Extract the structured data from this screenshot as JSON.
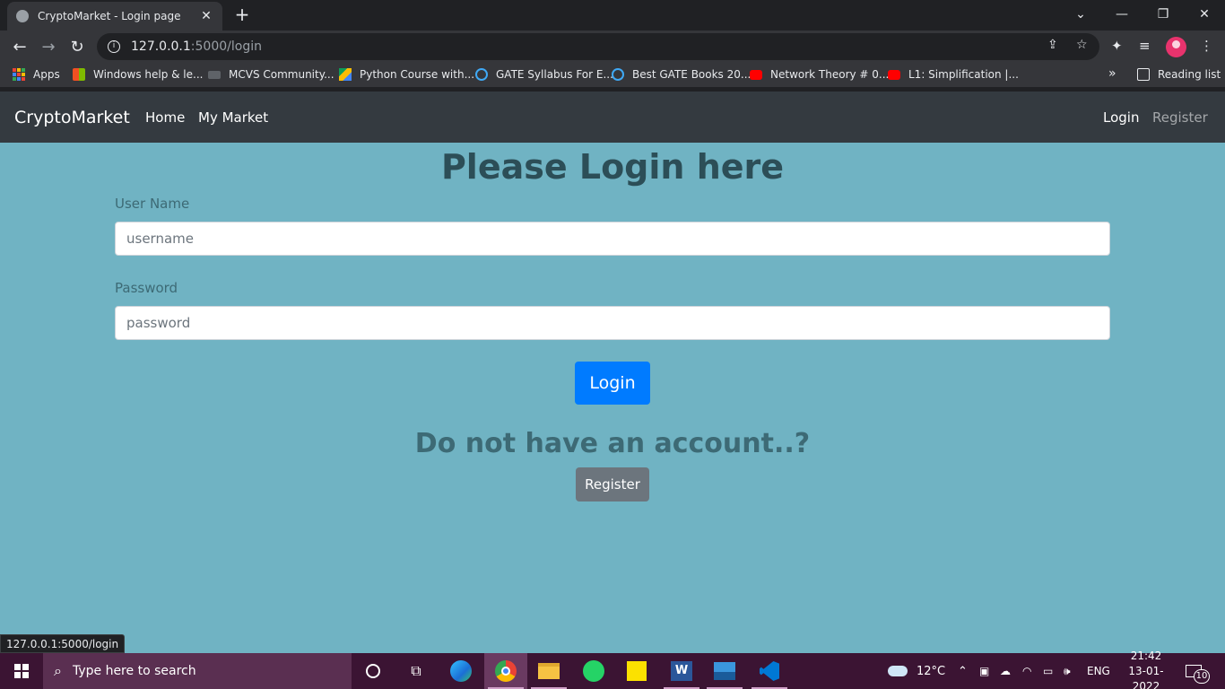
{
  "browser": {
    "tab_title": "CryptoMarket - Login page",
    "tab_close": "✕",
    "new_tab": "+",
    "url_host": "127.0.0.1",
    "url_path": ":5000/login",
    "window_controls": {
      "dropdown": "⌄",
      "minimize": "—",
      "restore": "❐",
      "close": "✕"
    }
  },
  "bookmarks": {
    "apps": "Apps",
    "items": [
      "Windows help & le...",
      "MCVS Community...",
      "Python Course with...",
      "GATE Syllabus For E...",
      "Best GATE Books 20...",
      "Network Theory # 0...",
      "L1: Simplification |..."
    ],
    "overflow": "»",
    "reading_list": "Reading list"
  },
  "navbar": {
    "brand": "CryptoMarket",
    "links": [
      "Home",
      "My Market"
    ],
    "login": "Login",
    "register": "Register"
  },
  "form": {
    "title": "Please Login here",
    "username_label": "User Name",
    "username_placeholder": "username",
    "password_label": "Password",
    "password_placeholder": "password",
    "login_button": "Login",
    "no_account_text": "Do not have an account..?",
    "register_button": "Register"
  },
  "status_bar": {
    "url": "127.0.0.1:5000/login"
  },
  "taskbar": {
    "search_placeholder": "Type here to search",
    "weather": "12°C",
    "language": "ENG",
    "time": "21:42",
    "date": "13-01-2022",
    "notifications": "10"
  },
  "colors": {
    "page_bg": "#70b3c3",
    "navbar_bg": "#343a40",
    "login_button": "#007bff",
    "register_button": "#6c757d",
    "taskbar_bg": "#3b1433"
  }
}
